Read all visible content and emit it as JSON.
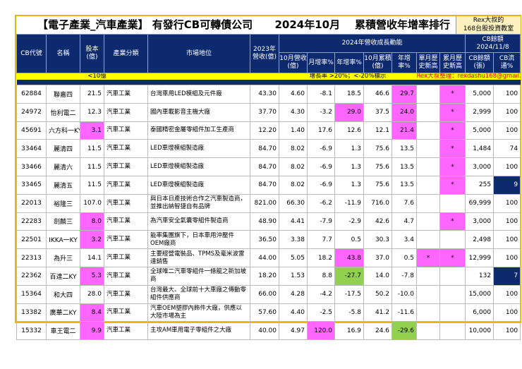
{
  "title": "【電子產業_汽車產業】 有發行CB可轉債公司      2024年10月    累積營收年增率排行",
  "brand": [
    "Rex大叔的",
    "168台股投資教室"
  ],
  "headers": {
    "code": "CB代號",
    "name": "名稱",
    "capital": "股本(億)",
    "industry": "產業分類",
    "market": "市場地位",
    "rev2023": "2023年營收(億)",
    "growth_group": "2024年營收成長動能",
    "cb_group": "CB餘額 2024/11/8",
    "oct_rev": "10月營收(億)",
    "mom": "月增率%",
    "yoy": "年增率%",
    "oct_cum": "10月累積(億)",
    "cum_yoy": "年增率%",
    "month_high": "單月歷史新高",
    "cum_high": "累月歷史新高",
    "cb_bal": "CB餘額(張)",
    "cb_float": "CB流通%"
  },
  "notes": {
    "capital": "<10億",
    "growth": "增長率 >20%；<-20%標示",
    "contact": "Rex大叔整理：rexdashu168@gmail.com"
  },
  "rows": [
    [
      "62884",
      "聯嘉四",
      "21.5",
      "汽車工業",
      "台灣車用LED模組及元件廠",
      "43.30",
      "4.60",
      "-8.1",
      "18.5",
      "46.6",
      "29.7",
      "",
      "*",
      "5,000",
      "100"
    ],
    [
      "24972",
      "怡利電二",
      "12.3",
      "汽車工業",
      "國內車載影音主機大廠",
      "37.70",
      "4.30",
      "-3.2",
      "29.0",
      "37.5",
      "24.0",
      "",
      "*",
      "2,999",
      "100"
    ],
    [
      "45691",
      "六方科一KY",
      "3.1",
      "汽車工業",
      "泰國精密金屬零組件加工生產商",
      "12.20",
      "1.40",
      "17.6",
      "12.6",
      "12.1",
      "21.4",
      "",
      "*",
      "5,000",
      "100"
    ],
    [
      "33464",
      "麗清四",
      "11.5",
      "汽車工業",
      "LED車燈模組製造廠",
      "84.70",
      "8.02",
      "-6.9",
      "1.3",
      "75.6",
      "13.5",
      "",
      "*",
      "1,484",
      "74"
    ],
    [
      "33466",
      "麗清六",
      "11.5",
      "汽車工業",
      "LED車燈模組製造廠",
      "84.70",
      "8.02",
      "-6.9",
      "1.3",
      "75.6",
      "13.5",
      "",
      "*",
      "3,000",
      "100"
    ],
    [
      "33465",
      "麗清五",
      "11.5",
      "汽車工業",
      "LED車燈模組製造廠",
      "84.70",
      "8.02",
      "-6.9",
      "1.3",
      "75.6",
      "13.5",
      "",
      "*",
      "255",
      "9"
    ],
    [
      "22013",
      "裕隆三",
      "107.0",
      "汽車工業",
      "與日本日產技術合作之汽車製造商，並推出納智捷自有品牌",
      "821.00",
      "66.30",
      "-6.2",
      "-11.9",
      "716.0",
      "7.6",
      "",
      "",
      "69,999",
      "100"
    ],
    [
      "22283",
      "劍麟三",
      "8.0",
      "汽車工業",
      "為汽車安全氣囊零組件製造商",
      "48.90",
      "4.41",
      "-7.9",
      "-2.9",
      "42.6",
      "4.7",
      "",
      "*",
      "3,000",
      "100"
    ],
    [
      "22501",
      "IKKA一KY",
      "3.2",
      "汽車工業",
      "能率集團旗下，日本車用沖壓件OEM廠商",
      "36.50",
      "3.38",
      "7.7",
      "0.5",
      "30.3",
      "3.4",
      "",
      "",
      "2,498",
      "100"
    ],
    [
      "22313",
      "為升三",
      "14.1",
      "汽車工業",
      "主要經營電裝品、TPMS及毫米波雷達銷售",
      "44.00",
      "5.05",
      "18.2",
      "43.8",
      "37.0",
      "0.5",
      "*",
      "*",
      "12,999",
      "100"
    ],
    [
      "22362",
      "百達二KY",
      "5.3",
      "汽車工業",
      "全球唯二汽車零組件一條龍之新加坡商",
      "18.20",
      "1.53",
      "8.8",
      "-27.7",
      "14.0",
      "-7.8",
      "",
      "",
      "132",
      "7"
    ],
    [
      "15364",
      "和大四",
      "28.0",
      "汽車工業",
      "台灣最大、全球前十大車廠之傳動零組件供應商",
      "66.00",
      "4.28",
      "-4.2",
      "-17.5",
      "50.2",
      "-10.0",
      "",
      "",
      "15,000",
      "100"
    ],
    [
      "13382",
      "廣華二KY",
      "8.4",
      "汽車工業",
      "汽車OEM塑膠內飾件大廠，供應以大陸市場為主",
      "57.60",
      "4.40",
      "-2.5",
      "-5.8",
      "41.2",
      "-11.6",
      "",
      "",
      "6,000",
      "100"
    ],
    [
      "15332",
      "車王電二",
      "9.9",
      "汽車工業",
      "主攻AM車用電子零組件之大廠",
      "40.00",
      "4.97",
      "120.0",
      "16.9",
      "24.6",
      "-29.6",
      "",
      "",
      "10,000",
      "100"
    ]
  ],
  "colors": {
    "navy": "#0e2a6e",
    "pink": "#ff66ff",
    "green": "#92d050",
    "yellow": "#ffff00",
    "gold": "#e6b800"
  }
}
